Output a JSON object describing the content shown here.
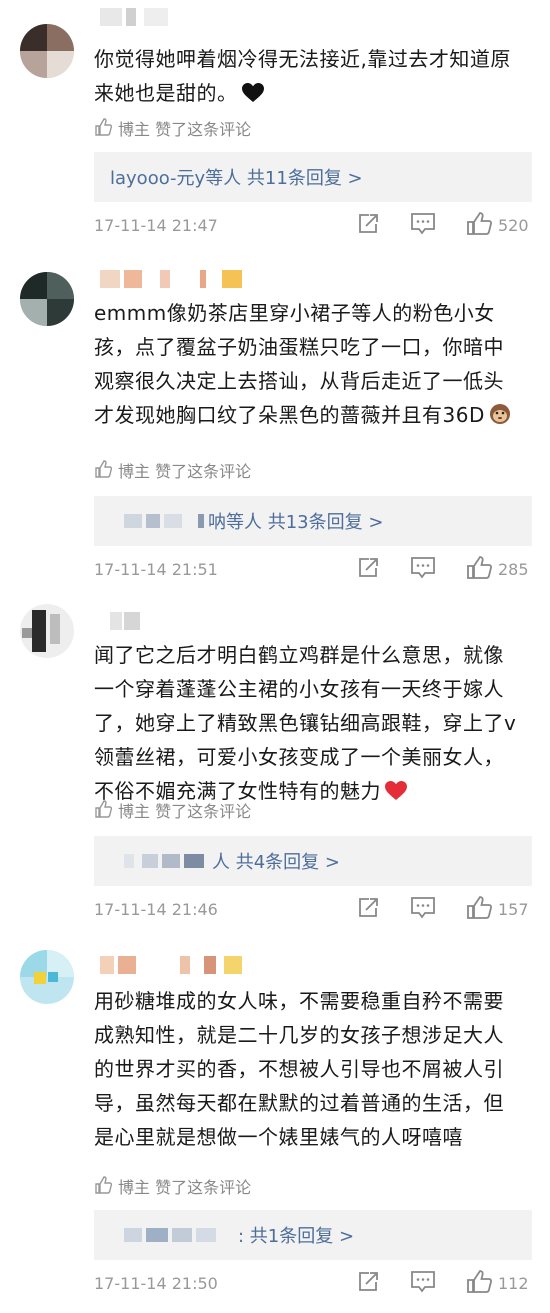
{
  "comments": [
    {
      "text": "你觉得她呷着烟冷得无法接近,靠过去才知道原来她也是甜的。",
      "emoji": "black-heart",
      "liked_by": "博主 赞了这条评论",
      "reply_suffix": "layooo-元y等人  共11条回复 >",
      "time": "17-11-14 21:47",
      "likes": "520"
    },
    {
      "text": "emmm像奶茶店里穿小裙子等人的粉色小女孩，点了覆盆子奶油蛋糕只吃了一口，你暗中观察很久决定上去搭讪，从背后走近了一低头才发现她胸口纹了朵黑色的蔷薇并且有36D",
      "emoji": "monkey-face",
      "liked_by": "博主 赞了这条评论",
      "reply_suffix": "呐等人  共13条回复 >",
      "time": "17-11-14 21:51",
      "likes": "285"
    },
    {
      "text": "闻了它之后才明白鹤立鸡群是什么意思，就像一个穿着蓬蓬公主裙的小女孩有一天终于嫁人了，她穿上了精致黑色镶钻细高跟鞋，穿上了v领蕾丝裙，可爱小女孩变成了一个美丽女人，不俗不媚充满了女性特有的魅力",
      "emoji": "red-heart",
      "liked_by": "博主 赞了这条评论",
      "reply_suffix": "人  共4条回复 >",
      "time": "17-11-14 21:46",
      "likes": "157"
    },
    {
      "text": "用砂糖堆成的女人味，不需要稳重自矜不需要成熟知性，就是二十几岁的女孩子想涉足大人的世界才买的香，不想被人引导也不屑被人引导，虽然每天都在默默的过着普通的生活，但是心里就是想做一个婊里婊气的人呀嘻嘻",
      "emoji": "",
      "liked_by": "博主 赞了这条评论",
      "reply_suffix": ": 共1条回复 >",
      "time": "17-11-14 21:50",
      "likes": "112"
    }
  ],
  "icons": {
    "liked": "thumb-up-outline-icon",
    "share": "share-icon",
    "comment": "comment-icon",
    "like": "thumb-up-icon"
  },
  "colors": {
    "reply_link": "#4e6e9a",
    "reply_bg": "#f2f2f2",
    "meta": "#999999"
  }
}
